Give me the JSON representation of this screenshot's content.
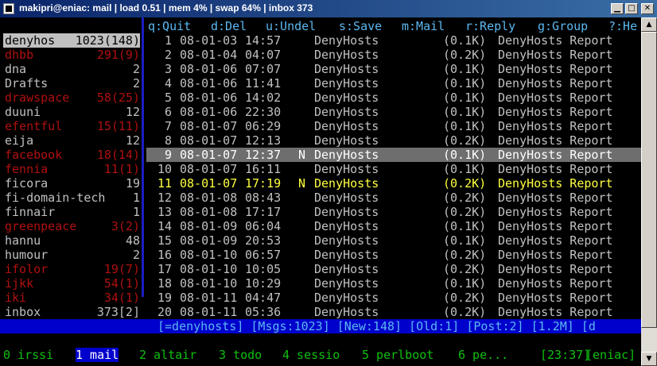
{
  "window": {
    "title": "makipri@eniac: mail | load 0.51 | mem 4% | swap 64% | inbox 373"
  },
  "colors": {
    "help": "#5bb8f0",
    "unread_folder": "#b01010",
    "current_msg": "#ffff40",
    "screen_active_bg": "#0000cc",
    "screen_text": "#10c010"
  },
  "helpbar": [
    {
      "label": "q:Quit",
      "left": 0
    },
    {
      "label": "d:Del",
      "left": 0
    },
    {
      "label": "u:Undel",
      "left": 0
    },
    {
      "label": "s:Save",
      "left": 0
    },
    {
      "label": "m:Mail",
      "left": 0
    },
    {
      "label": "r:Reply",
      "left": 0
    },
    {
      "label": "g:Group",
      "left": 0
    },
    {
      "label": "?:He",
      "left": 0
    }
  ],
  "folders": [
    {
      "name": "denyhos",
      "count": "1023(148)",
      "state": "selected"
    },
    {
      "name": "dhbb",
      "count": "291(9)",
      "state": "unread"
    },
    {
      "name": "dna",
      "count": "2",
      "state": "read"
    },
    {
      "name": "Drafts",
      "count": "2",
      "state": "read"
    },
    {
      "name": "drawspace",
      "count": "58(25)",
      "state": "unread"
    },
    {
      "name": "duuni",
      "count": "12",
      "state": "read"
    },
    {
      "name": "efentful",
      "count": "15(11)",
      "state": "unread"
    },
    {
      "name": "eija",
      "count": "12",
      "state": "read"
    },
    {
      "name": "facebook",
      "count": "18(14)",
      "state": "unread"
    },
    {
      "name": "fennia",
      "count": "11(1)",
      "state": "unread"
    },
    {
      "name": "ficora",
      "count": "19",
      "state": "read"
    },
    {
      "name": "fi-domain-tech",
      "count": "1",
      "state": "read"
    },
    {
      "name": "finnair",
      "count": "1",
      "state": "read"
    },
    {
      "name": "greenpeace",
      "count": "3(2)",
      "state": "unread"
    },
    {
      "name": "hannu",
      "count": "48",
      "state": "read"
    },
    {
      "name": "humour",
      "count": "2",
      "state": "read"
    },
    {
      "name": "ifolor",
      "count": "19(7)",
      "state": "unread"
    },
    {
      "name": "ijkk",
      "count": "54(1)",
      "state": "unread"
    },
    {
      "name": "iki",
      "count": "34(1)",
      "state": "unread"
    },
    {
      "name": "inbox",
      "count": "373[2]",
      "state": "read"
    }
  ],
  "messages": [
    {
      "num": "1",
      "date": "08-01-03",
      "time": "14:57",
      "flag": "",
      "from": "DenyHosts",
      "size": "(0.1K)",
      "subject": "DenyHosts Report",
      "state": "normal"
    },
    {
      "num": "2",
      "date": "08-01-04",
      "time": "04:07",
      "flag": "",
      "from": "DenyHosts",
      "size": "(0.2K)",
      "subject": "DenyHosts Report",
      "state": "normal"
    },
    {
      "num": "3",
      "date": "08-01-06",
      "time": "07:07",
      "flag": "",
      "from": "DenyHosts",
      "size": "(0.1K)",
      "subject": "DenyHosts Report",
      "state": "normal"
    },
    {
      "num": "4",
      "date": "08-01-06",
      "time": "11:41",
      "flag": "",
      "from": "DenyHosts",
      "size": "(0.1K)",
      "subject": "DenyHosts Report",
      "state": "normal"
    },
    {
      "num": "5",
      "date": "08-01-06",
      "time": "14:02",
      "flag": "",
      "from": "DenyHosts",
      "size": "(0.1K)",
      "subject": "DenyHosts Report",
      "state": "normal"
    },
    {
      "num": "6",
      "date": "08-01-06",
      "time": "22:30",
      "flag": "",
      "from": "DenyHosts",
      "size": "(0.1K)",
      "subject": "DenyHosts Report",
      "state": "normal"
    },
    {
      "num": "7",
      "date": "08-01-07",
      "time": "06:29",
      "flag": "",
      "from": "DenyHosts",
      "size": "(0.1K)",
      "subject": "DenyHosts Report",
      "state": "normal"
    },
    {
      "num": "8",
      "date": "08-01-07",
      "time": "12:13",
      "flag": "",
      "from": "DenyHosts",
      "size": "(0.2K)",
      "subject": "DenyHosts Report",
      "state": "normal"
    },
    {
      "num": "9",
      "date": "08-01-07",
      "time": "12:37",
      "flag": "N",
      "from": "DenyHosts",
      "size": "(0.1K)",
      "subject": "DenyHosts Report",
      "state": "cursor"
    },
    {
      "num": "10",
      "date": "08-01-07",
      "time": "16:11",
      "flag": "",
      "from": "DenyHosts",
      "size": "(0.1K)",
      "subject": "DenyHosts Report",
      "state": "normal"
    },
    {
      "num": "11",
      "date": "08-01-07",
      "time": "17:19",
      "flag": "N",
      "from": "DenyHosts",
      "size": "(0.2K)",
      "subject": "DenyHosts Report",
      "state": "current"
    },
    {
      "num": "12",
      "date": "08-01-08",
      "time": "08:43",
      "flag": "",
      "from": "DenyHosts",
      "size": "(0.2K)",
      "subject": "DenyHosts Report",
      "state": "normal"
    },
    {
      "num": "13",
      "date": "08-01-08",
      "time": "17:17",
      "flag": "",
      "from": "DenyHosts",
      "size": "(0.2K)",
      "subject": "DenyHosts Report",
      "state": "normal"
    },
    {
      "num": "14",
      "date": "08-01-09",
      "time": "06:04",
      "flag": "",
      "from": "DenyHosts",
      "size": "(0.1K)",
      "subject": "DenyHosts Report",
      "state": "normal"
    },
    {
      "num": "15",
      "date": "08-01-09",
      "time": "20:53",
      "flag": "",
      "from": "DenyHosts",
      "size": "(0.1K)",
      "subject": "DenyHosts Report",
      "state": "normal"
    },
    {
      "num": "16",
      "date": "08-01-10",
      "time": "06:57",
      "flag": "",
      "from": "DenyHosts",
      "size": "(0.2K)",
      "subject": "DenyHosts Report",
      "state": "normal"
    },
    {
      "num": "17",
      "date": "08-01-10",
      "time": "10:05",
      "flag": "",
      "from": "DenyHosts",
      "size": "(0.2K)",
      "subject": "DenyHosts Report",
      "state": "normal"
    },
    {
      "num": "18",
      "date": "08-01-10",
      "time": "10:29",
      "flag": "",
      "from": "DenyHosts",
      "size": "(0.1K)",
      "subject": "DenyHosts Report",
      "state": "normal"
    },
    {
      "num": "19",
      "date": "08-01-11",
      "time": "04:47",
      "flag": "",
      "from": "DenyHosts",
      "size": "(0.2K)",
      "subject": "DenyHosts Report",
      "state": "normal"
    },
    {
      "num": "20",
      "date": "08-01-11",
      "time": "05:36",
      "flag": "",
      "from": "DenyHosts",
      "size": "(0.2K)",
      "subject": "DenyHosts Report",
      "state": "normal"
    }
  ],
  "statusbar": {
    "text": "[=denyhosts] [Msgs:1023] [New:148] [Old:1] [Post:2] [1.2M] [d"
  },
  "screens": [
    {
      "label": "0 irssi",
      "active": false
    },
    {
      "label": "1 mail",
      "active": true
    },
    {
      "label": "2 altair",
      "active": false
    },
    {
      "label": "3 todo",
      "active": false
    },
    {
      "label": "4 sessio",
      "active": false
    },
    {
      "label": "5 perlboot",
      "active": false
    },
    {
      "label": "6 pe...",
      "active": false
    },
    {
      "label": "[23:37]",
      "active": false
    },
    {
      "label": "[eniac]",
      "active": false
    }
  ],
  "icons": {
    "minimize": "minimize-icon",
    "maximize": "maximize-icon",
    "close": "close-icon",
    "scroll_up": "arrow-up-icon",
    "scroll_down": "arrow-down-icon"
  }
}
